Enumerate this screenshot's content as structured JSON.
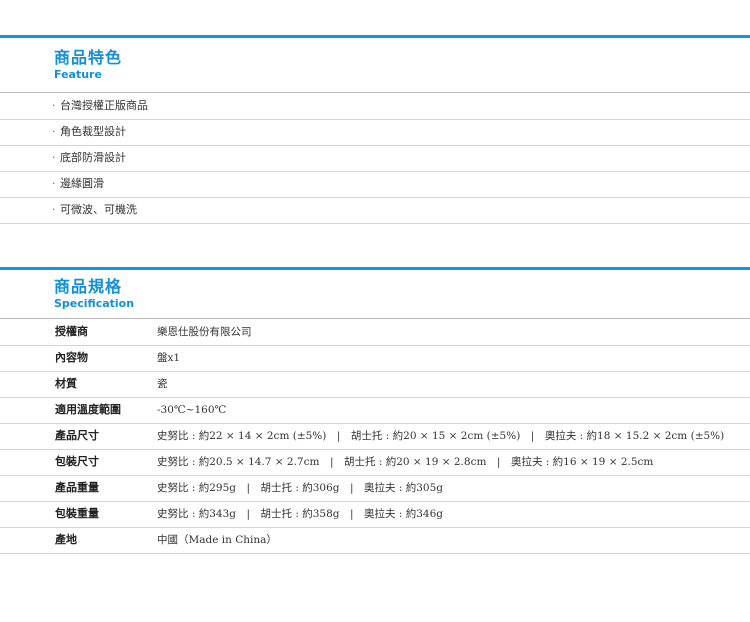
{
  "feature": {
    "title_zh": "商品特色",
    "title_en": "Feature",
    "items": [
      "台灣授權正版商品",
      "角色裁型設計",
      "底部防滑設計",
      "邊緣圓滑",
      "可微波、可機洗"
    ]
  },
  "spec": {
    "title_zh": "商品規格",
    "title_en": "Specification",
    "rows": [
      {
        "label": "授權商",
        "value": "樂恩仕股份有限公司"
      },
      {
        "label": "內容物",
        "value": "盤x1"
      },
      {
        "label": "材質",
        "value": "瓷"
      },
      {
        "label": "適用溫度範圍",
        "value": "-30℃~160℃"
      },
      {
        "label": "產品尺寸",
        "value": "史努比 : 約22 × 14 × 2cm (±5%)　|　胡士托 : 約20 × 15 × 2cm (±5%)　|　奧拉夫 : 約18 × 15.2 × 2cm (±5%)"
      },
      {
        "label": "包裝尺寸",
        "value": "史努比 : 約20.5 × 14.7 × 2.7cm　|　胡士托 : 約20 × 19 × 2.8cm　|　奧拉夫 : 約16 × 19 × 2.5cm"
      },
      {
        "label": "產品重量",
        "value": "史努比 : 約295g　|　胡士托 : 約306g　|　奧拉夫 : 約305g"
      },
      {
        "label": "包裝重量",
        "value": "史努比 : 約343g　|　胡士托 : 約358g　|　奧拉夫 : 約346g"
      },
      {
        "label": "產地",
        "value": "中國（Made in China）"
      }
    ]
  },
  "bullet": "·",
  "colors": {
    "accent": "#1496e0",
    "title": "#1190dc",
    "divider": "#d5d5d5"
  }
}
